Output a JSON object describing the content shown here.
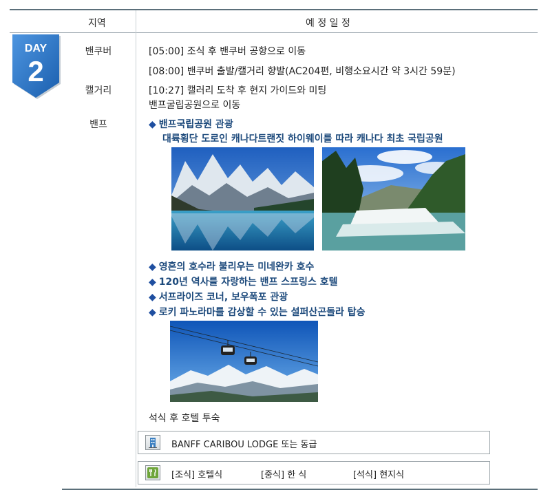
{
  "header": {
    "region_label": "지역",
    "schedule_label": "예 정 일 정"
  },
  "day": {
    "label": "DAY",
    "number": "2"
  },
  "regions": [
    "밴쿠버",
    "캘거리",
    "밴프"
  ],
  "schedule": [
    "[05:00] 조식 후 밴쿠버 공항으로 이동",
    "[08:00] 밴쿠버 출발/캘거리 향발(AC204편, 비행소요시간 약 3시간 59분)",
    "[10:27] 캘러리 도착 후 현지 가이드와 미팅",
    "밴프굴립공원으로 이동"
  ],
  "highlight_main": {
    "bullet": "◆",
    "title": "밴프국립공원 관광",
    "subtitle": "대륙횡단 도로인 캐나다트랜짓 하이웨이를 따라 캐나다 최초 국립공원"
  },
  "highlights": [
    {
      "bullet": "◆",
      "text": "영혼의 호수라 불리우는 미네완카 호수"
    },
    {
      "bullet": "◆",
      "text": "120년 역사를 자랑하는 밴프 스프링스 호텔"
    },
    {
      "bullet": "◆",
      "text": "서프라이즈 코너, 보우폭포 관광"
    },
    {
      "bullet": "◆",
      "text": "로키 파노라마를 감상할 수 있는 설퍼산곤돌라 탑승"
    }
  ],
  "closing_note": "석식 후 호텔 투숙",
  "hotel": {
    "icon": "hotel-icon",
    "text": "BANFF CARIBOU LODGE  또는 동급"
  },
  "meals": {
    "icon": "meal-icon",
    "breakfast": "[조식] 호텔식",
    "lunch": "[중식] 한   식",
    "dinner": "[석식] 현지식"
  },
  "colors": {
    "badge": "#2a73c6",
    "highlight": "#1d4a7c",
    "rule": "#5b6f7a"
  }
}
